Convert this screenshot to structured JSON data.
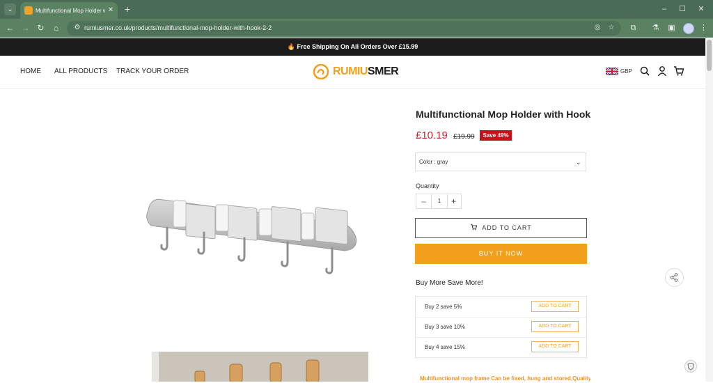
{
  "browser": {
    "tab_title": "Multifunctional Mop Holder wi",
    "tab_close": "✕",
    "new_tab": "+",
    "url": "rumiusmer.co.uk/products/multifunctional-mop-holder-with-hook-2-2",
    "window_min": "–",
    "window_max": "☐",
    "window_close": "✕"
  },
  "announcement": "🔥 Free Shipping On All Orders Over £15.99",
  "nav": {
    "home": "HOME",
    "all_products": "ALL PRODUCTS",
    "track": "TRACK YOUR ORDER"
  },
  "logo": {
    "part1": "RUMIU",
    "part2": "SMER"
  },
  "currency": "GBP",
  "product": {
    "title": "Multifunctional Mop Holder with Hook",
    "price": "£10.19",
    "compare_price": "£19.99",
    "save_badge": "Save 49%",
    "color_label": "Color : gray",
    "quantity_label": "Quantity",
    "quantity": "1",
    "add_to_cart": "ADD TO CART",
    "buy_now": "BUY IT NOW",
    "bundle_title": "Buy More Save More!",
    "offers": [
      {
        "label": "Buy 2 save 5%",
        "button": "ADD TO CART"
      },
      {
        "label": "Buy 3 save 10%",
        "button": "ADD TO CART"
      },
      {
        "label": "Buy 4 save 15%",
        "button": "ADD TO CART"
      }
    ],
    "description_teaser": "Multifunctional mop frame Can be fixed, hung and stored,Quality life starts"
  },
  "colors": {
    "tab_bar": "#4a6b56",
    "toolbar": "#5b8163",
    "accent_orange": "#f19f1d",
    "price_red": "#d4202a",
    "badge_red": "#c9111b"
  }
}
